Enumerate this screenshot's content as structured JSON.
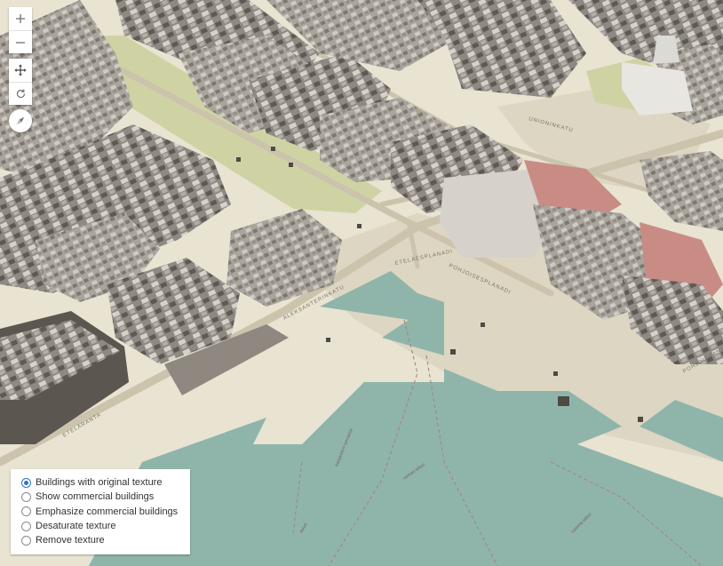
{
  "map": {
    "colors": {
      "water": "#8fb5ab",
      "land": "#e9e3d2",
      "plaza": "#ddd6c2",
      "park": "#cfd3a4",
      "road": "#ccc3ad",
      "building_roof": "#b9b5ad",
      "building_dark": "#6b6560",
      "building_red": "#c98c84"
    },
    "street_labels": [
      "ETELÄRANTA",
      "POHJOISESPLANADI",
      "ETELÄESPLANADI",
      "POHJOISRANTA",
      "ALEKSANTERINKATU",
      "UNIONINKATU"
    ],
    "water_labels": [
      "kauppatori rannassa",
      "rannan laituri",
      "satama laituri",
      "laituri"
    ]
  },
  "controls": {
    "zoom_in_icon": "plus-icon",
    "zoom_out_icon": "minus-icon",
    "pan_icon": "pan-arrows-icon",
    "rotate_icon": "rotate-icon",
    "compass_icon": "compass-icon"
  },
  "options": {
    "selected_index": 0,
    "items": [
      {
        "label": "Buildings with original texture",
        "checked": true
      },
      {
        "label": "Show commercial buildings",
        "checked": false
      },
      {
        "label": "Emphasize commercial buildings",
        "checked": false
      },
      {
        "label": "Desaturate texture",
        "checked": false
      },
      {
        "label": "Remove texture",
        "checked": false
      }
    ]
  }
}
